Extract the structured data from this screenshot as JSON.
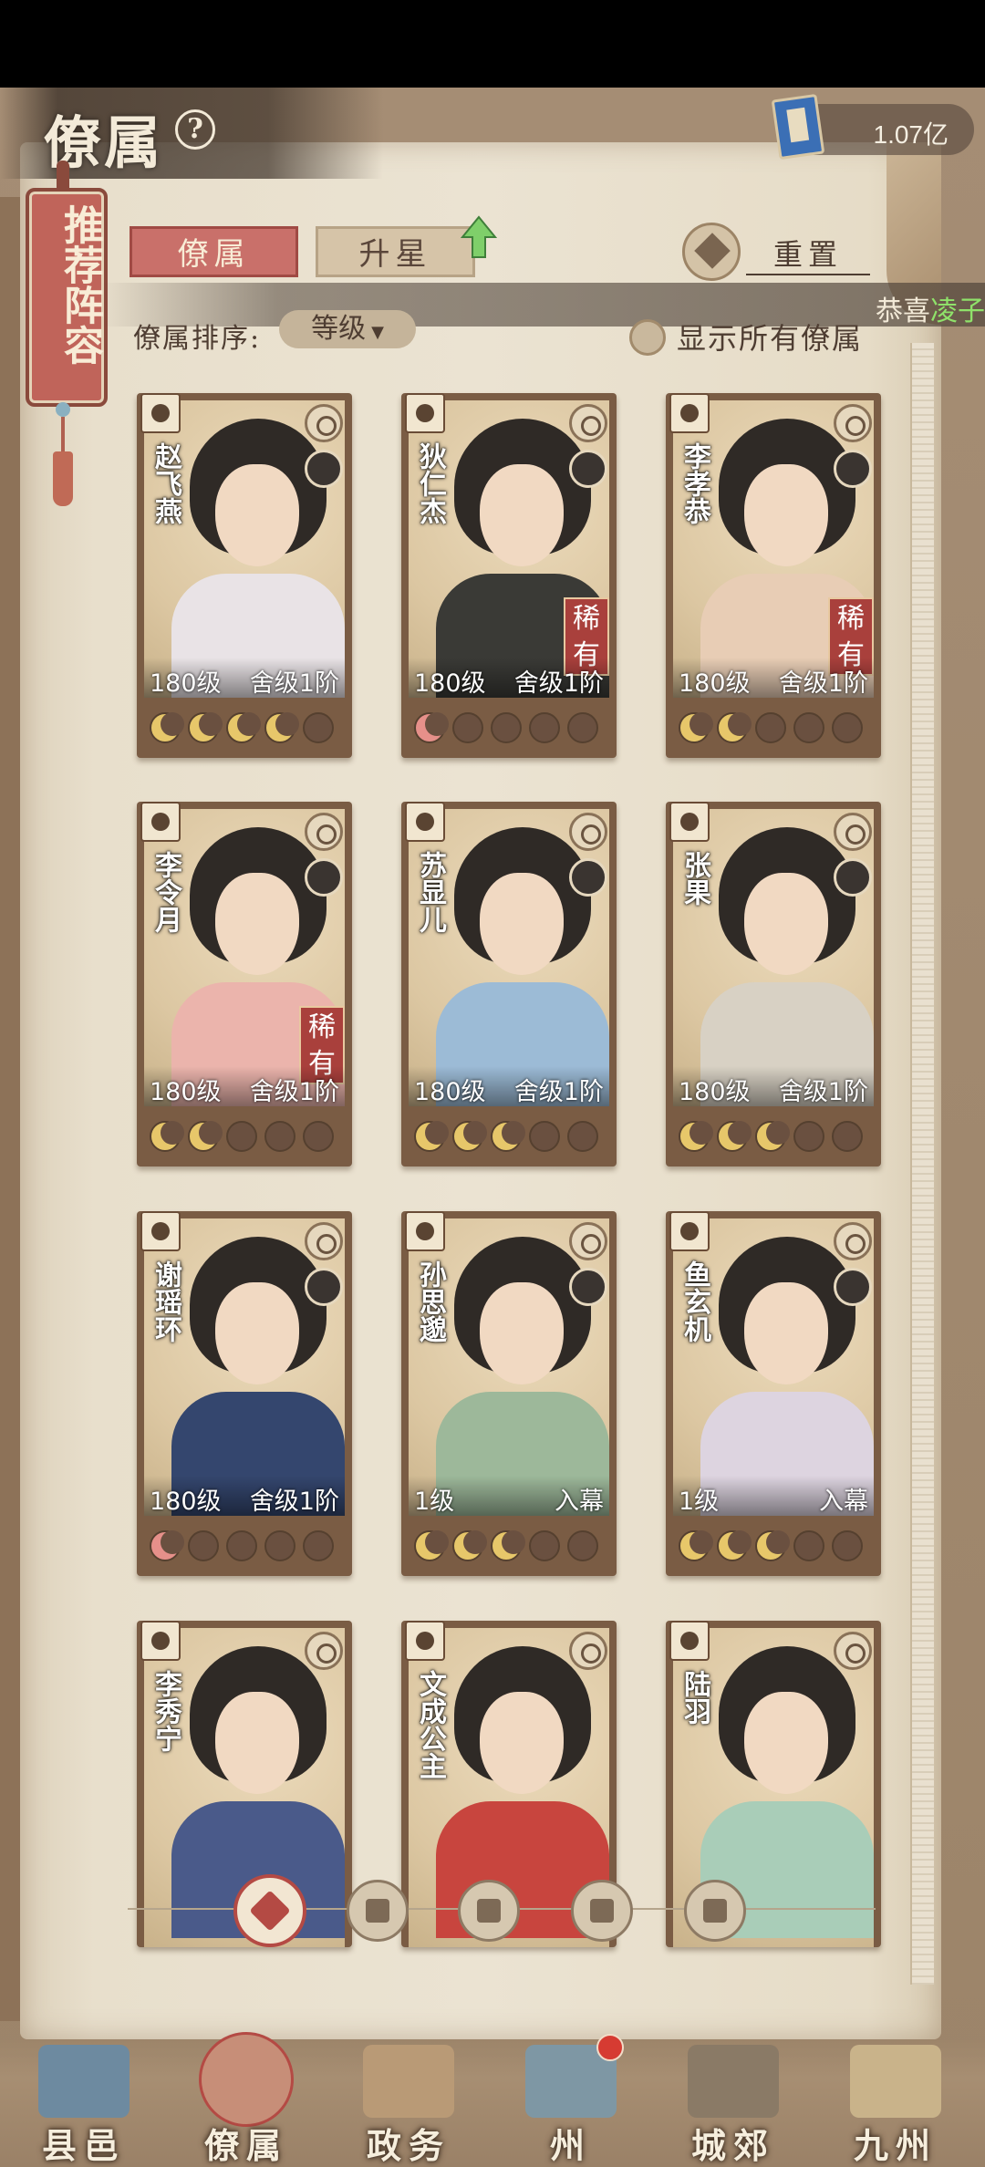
{
  "header": {
    "title": "僚属",
    "currency_value": "1.07亿"
  },
  "recommend_banner": "推荐阵容",
  "tabs": [
    {
      "label": "僚属",
      "active": true
    },
    {
      "label": "升星",
      "active": false
    }
  ],
  "reset_label": "重置",
  "congrats": {
    "prefix": "恭喜",
    "name": "凌子"
  },
  "sort": {
    "label": "僚属排序:",
    "value": "等级"
  },
  "show_all_label": "显示所有僚属",
  "cards": [
    {
      "name": "赵飞燕",
      "level": "180级",
      "rank": "舍级1阶",
      "rare": "",
      "moons": [
        "full",
        "full",
        "full",
        "full",
        "empty"
      ],
      "robe": "#e9e3e6"
    },
    {
      "name": "狄仁杰",
      "level": "180级",
      "rank": "舍级1阶",
      "rare": "稀有",
      "moons": [
        "red",
        "empty",
        "empty",
        "empty",
        "empty"
      ],
      "robe": "#3a3a36"
    },
    {
      "name": "李孝恭",
      "level": "180级",
      "rank": "舍级1阶",
      "rare": "稀有",
      "moons": [
        "full",
        "full",
        "empty",
        "empty",
        "empty"
      ],
      "robe": "#e8cdb5"
    },
    {
      "name": "李令月",
      "level": "180级",
      "rank": "舍级1阶",
      "rare": "稀有",
      "moons": [
        "full",
        "full",
        "empty",
        "empty",
        "empty"
      ],
      "robe": "#ebb4ac"
    },
    {
      "name": "苏显儿",
      "level": "180级",
      "rank": "舍级1阶",
      "rare": "",
      "moons": [
        "full",
        "full",
        "full",
        "empty",
        "empty"
      ],
      "robe": "#9cbbd6"
    },
    {
      "name": "张果",
      "level": "180级",
      "rank": "舍级1阶",
      "rare": "",
      "moons": [
        "full",
        "full",
        "full",
        "empty",
        "empty"
      ],
      "robe": "#d8d1c4"
    },
    {
      "name": "谢瑶环",
      "level": "180级",
      "rank": "舍级1阶",
      "rare": "",
      "moons": [
        "red",
        "empty",
        "empty",
        "empty",
        "empty"
      ],
      "robe": "#34466e"
    },
    {
      "name": "孙思邈",
      "level": "1级",
      "rank": "入幕",
      "rare": "",
      "moons": [
        "full",
        "full",
        "full",
        "empty",
        "empty"
      ],
      "robe": "#9db89a"
    },
    {
      "name": "鱼玄机",
      "level": "1级",
      "rank": "入幕",
      "rare": "",
      "moons": [
        "full",
        "full",
        "full",
        "empty",
        "empty"
      ],
      "robe": "#ddd4e0"
    },
    {
      "name": "李秀宁",
      "level": "",
      "rank": "",
      "rare": "",
      "moons": [],
      "robe": "#4a5a8a"
    },
    {
      "name": "文成公主",
      "level": "",
      "rank": "",
      "rare": "",
      "moons": [],
      "robe": "#c8453e"
    },
    {
      "name": "陆羽",
      "level": "",
      "rank": "",
      "rare": "",
      "moons": [],
      "robe": "#a9cdb8"
    }
  ],
  "filters": [
    "all-icon",
    "scholar-icon",
    "gourd-icon",
    "fan-icon",
    "lion-icon"
  ],
  "bottom_nav": [
    {
      "label": "县邑",
      "active": false,
      "color": "#6d8aa0"
    },
    {
      "label": "僚属",
      "active": true,
      "color": "#c78e78"
    },
    {
      "label": "政务",
      "active": false,
      "color": "#b99a76"
    },
    {
      "label": "州",
      "active": false,
      "color": "#7e97a4"
    },
    {
      "label": "城郊",
      "active": false,
      "color": "#8a7a66"
    },
    {
      "label": "九州",
      "active": false,
      "color": "#c9b38a"
    }
  ]
}
